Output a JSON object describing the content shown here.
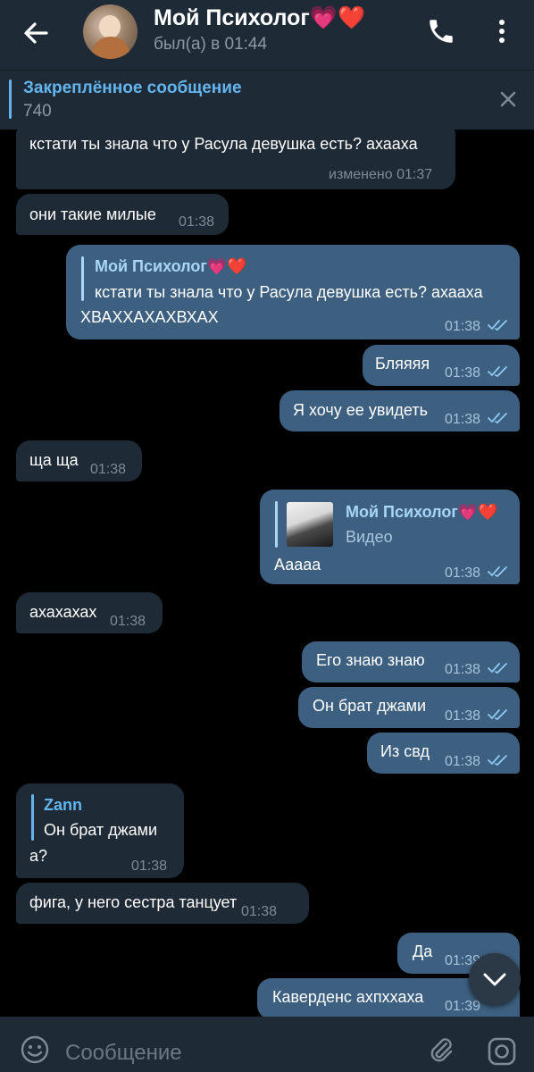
{
  "header": {
    "title": "Мой Психолог💗❤️",
    "status": "был(а) в 01:44",
    "back_icon": "arrow-left-icon",
    "call_icon": "phone-icon",
    "menu_icon": "more-vert-icon"
  },
  "pinned": {
    "title": "Закреплённое сообщение",
    "text": "740",
    "close_icon": "close-icon"
  },
  "messages": [
    {
      "text": "кстати ты знала что у Расула девушка есть? ахааха",
      "time": "изменено 01:37"
    },
    {
      "text": "они такие милые",
      "time": "01:38"
    },
    {
      "reply_name": "Мой Психолог💗❤️",
      "reply_text": "кстати ты знала что у Расула девушка есть? ахааха",
      "text": "ХВАХХАХАХВХАХ",
      "time": "01:38"
    },
    {
      "text": "Бляяяя",
      "time": "01:38"
    },
    {
      "text": "Я хочу ее увидеть",
      "time": "01:38"
    },
    {
      "text": "ща ща",
      "time": "01:38"
    },
    {
      "reply_name": "Мой Психолог💗❤️",
      "reply_text": "Видео",
      "text": "Ааааа",
      "time": "01:38"
    },
    {
      "text": "ахахахах",
      "time": "01:38"
    },
    {
      "text": "Его знаю знаю",
      "time": "01:38"
    },
    {
      "text": "Он брат джами",
      "time": "01:38"
    },
    {
      "text": "Из свд",
      "time": "01:38"
    },
    {
      "reply_name": "Zann",
      "reply_text": "Он брат джами",
      "text": "а?",
      "time": "01:38"
    },
    {
      "text": "фига, у него сестра танцует",
      "time": "01:38"
    },
    {
      "text": "Да",
      "time": "01:39"
    },
    {
      "text": "Каверденс ахпххаха",
      "time": "01:39"
    }
  ],
  "input": {
    "placeholder": "Сообщение",
    "emoji_icon": "emoji-icon",
    "attach_icon": "paperclip-icon",
    "camera_icon": "camera-icon"
  },
  "scroll_icon": "chevron-down-icon",
  "colors": {
    "background": "#000000",
    "bar": "#1e2a36",
    "incoming": "#1e2a36",
    "outgoing": "#3d6080",
    "accent": "#64b5ef"
  }
}
